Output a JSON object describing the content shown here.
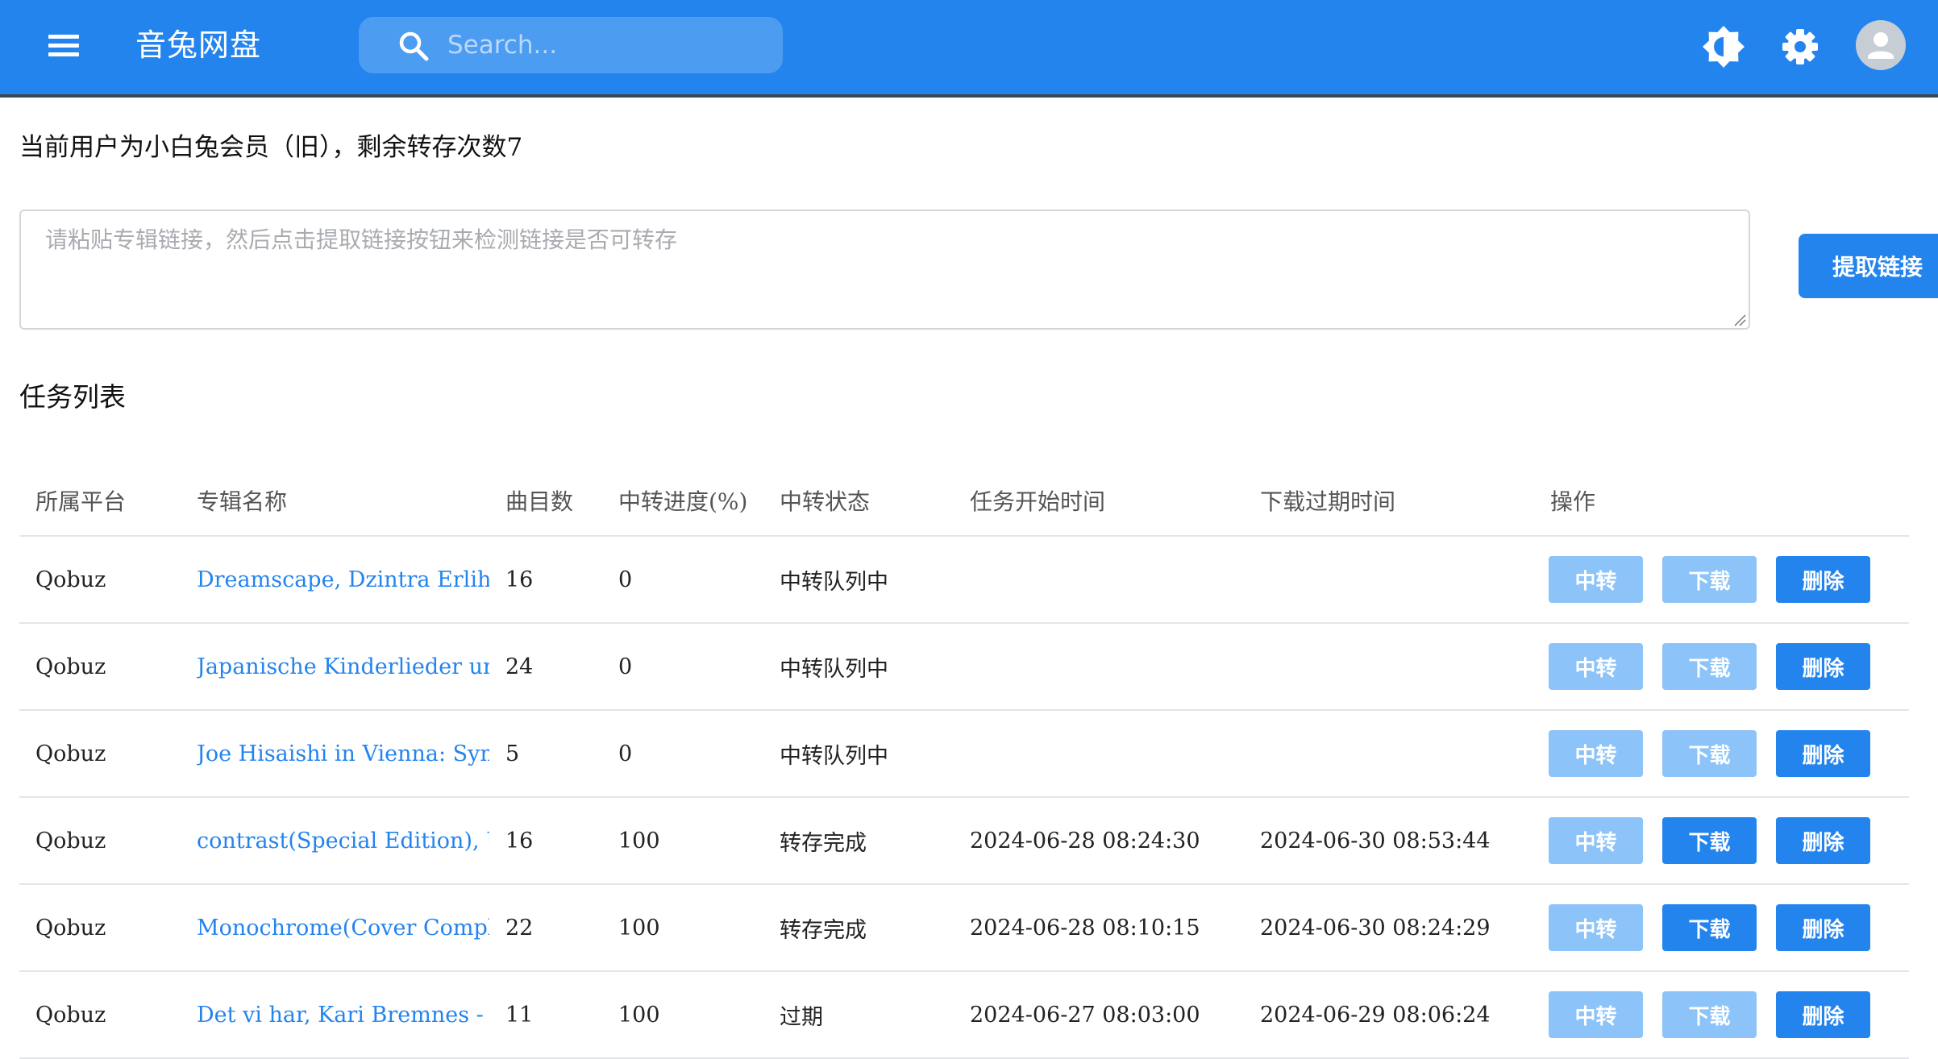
{
  "app": {
    "title": "音兔网盘",
    "search_placeholder": "Search...",
    "primary_color": "#2384ee"
  },
  "icons": {
    "menu": "menu-icon",
    "search": "search-icon",
    "theme": "brightness-icon",
    "settings": "gear-icon",
    "avatar": "user-avatar-icon"
  },
  "user_info": "当前用户为小白兔会员（旧），剩余转存次数7",
  "link_input": {
    "placeholder": "请粘贴专辑链接，然后点击提取链接按钮来检测链接是否可转存",
    "value": ""
  },
  "extract_button": "提取链接",
  "task_section_title": "任务列表",
  "table": {
    "headers": [
      "所属平台",
      "专辑名称",
      "曲目数",
      "中转进度(%)",
      "中转状态",
      "任务开始时间",
      "下载过期时间",
      "操作"
    ],
    "action_labels": {
      "transfer": "中转",
      "download": "下载",
      "delete": "删除"
    },
    "rows": [
      {
        "platform": "Qobuz",
        "album": "Dreamscape, Dzintra Erliha - Qobuz",
        "tracks": "16",
        "progress": "0",
        "status": "中转队列中",
        "start": "",
        "expire": "",
        "download_enabled": false
      },
      {
        "platform": "Qobuz",
        "album": "Japanische Kinderlieder und Lieder",
        "tracks": "24",
        "progress": "0",
        "status": "中转队列中",
        "start": "",
        "expire": "",
        "download_enabled": false
      },
      {
        "platform": "Qobuz",
        "album": "Joe Hisaishi in Vienna: Symphony",
        "tracks": "5",
        "progress": "0",
        "status": "中转队列中",
        "start": "",
        "expire": "",
        "download_enabled": false
      },
      {
        "platform": "Qobuz",
        "album": "contrast(Special Edition), URU - Qobuz",
        "tracks": "16",
        "progress": "100",
        "status": "转存完成",
        "start": "2024-06-28 08:24:30",
        "expire": "2024-06-30 08:53:44",
        "download_enabled": true
      },
      {
        "platform": "Qobuz",
        "album": "Monochrome(Cover Complete Edition)",
        "tracks": "22",
        "progress": "100",
        "status": "转存完成",
        "start": "2024-06-28 08:10:15",
        "expire": "2024-06-30 08:24:29",
        "download_enabled": true
      },
      {
        "platform": "Qobuz",
        "album": "Det vi har, Kari Bremnes - Qobuz",
        "tracks": "11",
        "progress": "100",
        "status": "过期",
        "start": "2024-06-27 08:03:00",
        "expire": "2024-06-29 08:06:24",
        "download_enabled": false
      }
    ]
  }
}
